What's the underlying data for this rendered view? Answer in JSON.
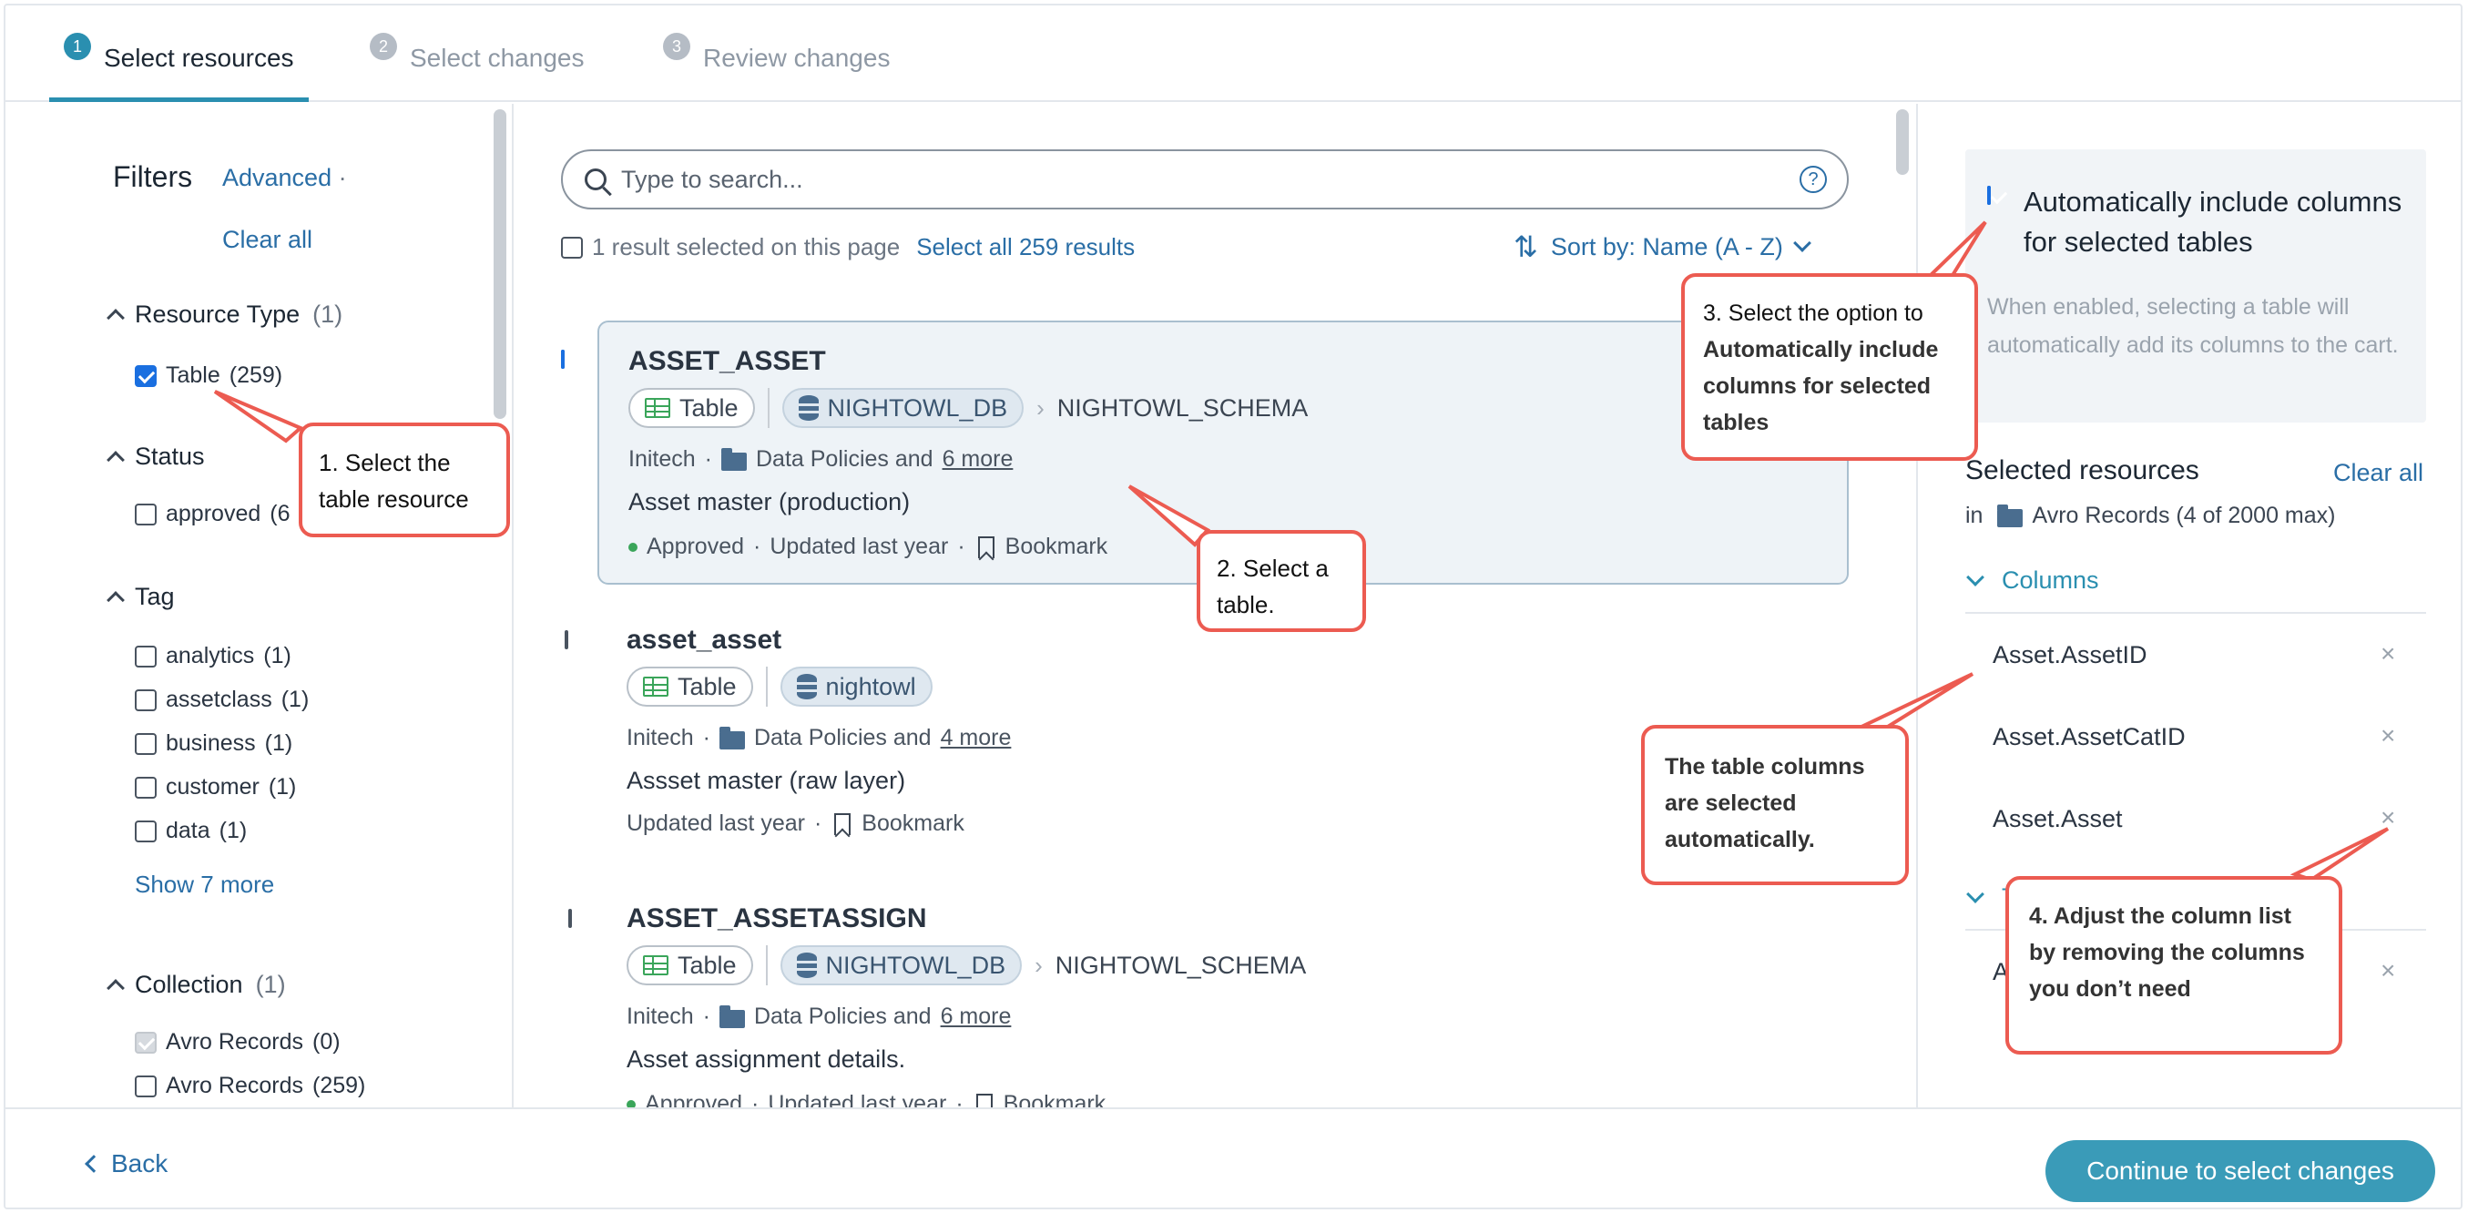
{
  "stepper": {
    "steps": [
      {
        "num": "1",
        "label": "Select resources"
      },
      {
        "num": "2",
        "label": "Select changes"
      },
      {
        "num": "3",
        "label": "Review changes"
      }
    ]
  },
  "filters": {
    "title": "Filters",
    "advanced": "Advanced",
    "advanced_suffix": "·",
    "clear_all": "Clear all",
    "resource_type": {
      "label": "Resource Type",
      "count": "(1)",
      "items": [
        {
          "label": "Table",
          "count": "(259)"
        }
      ]
    },
    "status": {
      "label": "Status",
      "items": [
        {
          "label": "approved",
          "count": "(6"
        }
      ]
    },
    "tag": {
      "label": "Tag",
      "items": [
        {
          "label": "analytics",
          "count": "(1)"
        },
        {
          "label": "assetclass",
          "count": "(1)"
        },
        {
          "label": "business",
          "count": "(1)"
        },
        {
          "label": "customer",
          "count": "(1)"
        },
        {
          "label": "data",
          "count": "(1)"
        }
      ],
      "show_more": "Show 7 more"
    },
    "collection": {
      "label": "Collection",
      "count": "(1)",
      "items": [
        {
          "label": "Avro Records",
          "count": "(0)"
        },
        {
          "label": "Avro Records",
          "count": "(259)"
        }
      ]
    }
  },
  "search": {
    "placeholder": "Type to search...",
    "help": "?"
  },
  "results": {
    "selected_text": "1 result selected on this page",
    "select_all": "Select all 259 results",
    "sort": "Sort by: Name (A - Z)",
    "cards": [
      {
        "title": "ASSET_ASSET",
        "type": "Table",
        "db": "NIGHTOWL_DB",
        "schema": "NIGHTOWL_SCHEMA",
        "owner": "Initech",
        "folder": "Data Policies and",
        "more": "6 more",
        "desc": "Asset master (production)",
        "status": "Approved",
        "updated": "Updated last year",
        "bookmark": "Bookmark"
      },
      {
        "title": "asset_asset",
        "type": "Table",
        "db": "nightowl",
        "owner": "Initech",
        "folder": "Data Policies and",
        "more": "4 more",
        "desc": "Assset master (raw layer)",
        "updated": "Updated last year",
        "bookmark": "Bookmark"
      },
      {
        "title": "ASSET_ASSETASSIGN",
        "type": "Table",
        "db": "NIGHTOWL_DB",
        "schema": "NIGHTOWL_SCHEMA",
        "owner": "Initech",
        "folder": "Data Policies and",
        "more": "6 more",
        "desc": "Asset assignment details.",
        "status": "Approved",
        "updated": "Updated last year",
        "bookmark": "Bookmark"
      }
    ],
    "dot": "·"
  },
  "cart": {
    "auto_include_label": "Automatically include columns for selected tables",
    "auto_include_help": "When enabled, selecting a table will automatically add its columns to the cart.",
    "selected_title": "Selected resources",
    "clear_all": "Clear all",
    "in": "in",
    "collection": "Avro Records (4 of 2000 max)",
    "columns_label": "Columns",
    "columns": [
      "Asset.AssetID",
      "Asset.AssetCatID",
      "Asset.Asset"
    ],
    "tables_partial": "T",
    "table_partial": "A"
  },
  "footer": {
    "back": "Back",
    "continue": "Continue to select changes"
  },
  "callouts": {
    "c1": "1. Select the table resource",
    "c2": "2. Select a table.",
    "c3_line1": "3. Select the option to",
    "c3_rest": "Automatically include columns for selected tables",
    "c4": "The table columns are selected automatically.",
    "c5": "4. Adjust the column list by removing the columns you don’t need"
  },
  "colors": {
    "accent": "#2a8fb0",
    "link": "#2a6ea6",
    "callout": "#ec5b51",
    "approved": "#3aa55a"
  }
}
